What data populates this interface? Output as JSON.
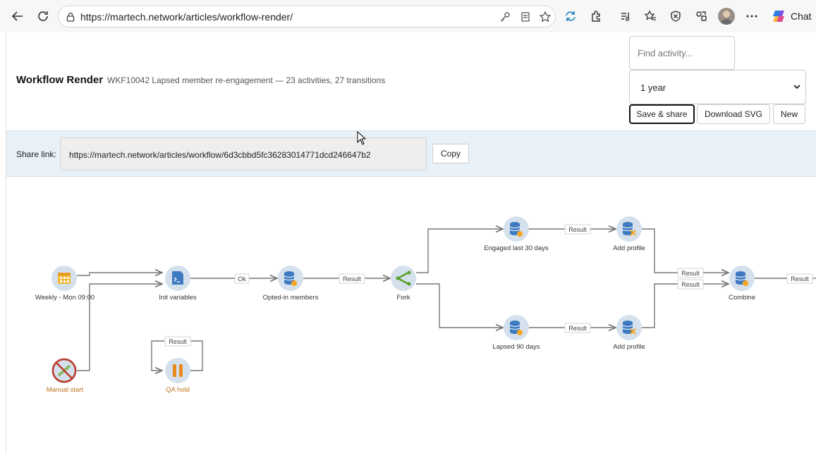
{
  "browser": {
    "url": "https://martech.network/articles/workflow-render/",
    "chat_label": "Chat"
  },
  "header": {
    "title": "Workflow Render",
    "subtitle": "WKF10042 Lapsed member re-engagement — 23 activities, 27 transitions",
    "find_placeholder": "Find activity...",
    "range_value": "1 year",
    "save_label": "Save & share",
    "download_label": "Download SVG",
    "new_label": "New"
  },
  "share": {
    "label": "Share link:",
    "link": "https://martech.network/articles/workflow/6d3cbbd5fc36283014771dcd246647b2",
    "copy_label": "Copy"
  },
  "workflow": {
    "nodes": [
      {
        "id": "weekly",
        "label": "Weekly - Mon 09:00",
        "icon": "calendar-icon",
        "status": "normal"
      },
      {
        "id": "manual",
        "label": "Manual start",
        "icon": "disabled-start-icon",
        "status": "disabled"
      },
      {
        "id": "init",
        "label": "Init variables",
        "icon": "script-icon",
        "status": "normal"
      },
      {
        "id": "qa",
        "label": "QA hold",
        "icon": "pause-icon",
        "status": "paused"
      },
      {
        "id": "optin",
        "label": "Opted-in members",
        "icon": "query-icon",
        "status": "normal"
      },
      {
        "id": "fork",
        "label": "Fork",
        "icon": "fork-icon",
        "status": "normal"
      },
      {
        "id": "engaged",
        "label": "Engaged last 30 days",
        "icon": "query-icon",
        "status": "normal"
      },
      {
        "id": "lapsed",
        "label": "Lapsed 90 days",
        "icon": "query-icon",
        "status": "normal"
      },
      {
        "id": "addprof1",
        "label": "Add profile",
        "icon": "enrich-icon",
        "status": "normal"
      },
      {
        "id": "addprof2",
        "label": "Add profile",
        "icon": "enrich-icon",
        "status": "normal"
      },
      {
        "id": "combine",
        "label": "Combine",
        "icon": "combine-icon",
        "status": "normal"
      }
    ],
    "transition_labels": {
      "ok": "Ok",
      "result": "Result"
    },
    "colors": {
      "node_bg": "#d4e1ec",
      "edge": "#777777",
      "warn_label": "#c0701d",
      "disabled": "#c0392b"
    }
  }
}
